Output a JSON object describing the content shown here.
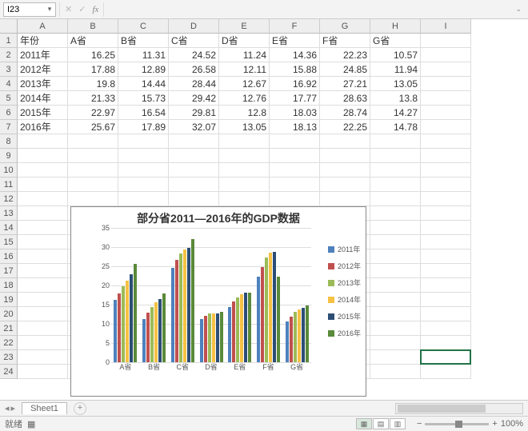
{
  "namebox": "I23",
  "sheet_tab": "Sheet1",
  "zoom_label": "100%",
  "status_text": "就绪",
  "columns": [
    "A",
    "B",
    "C",
    "D",
    "E",
    "F",
    "G",
    "H",
    "I"
  ],
  "row_count": 24,
  "headers": [
    "年份",
    "A省",
    "B省",
    "C省",
    "D省",
    "E省",
    "F省",
    "G省"
  ],
  "data_rows": [
    [
      "2011年",
      "16.25",
      "11.31",
      "24.52",
      "11.24",
      "14.36",
      "22.23",
      "10.57"
    ],
    [
      "2012年",
      "17.88",
      "12.89",
      "26.58",
      "12.11",
      "15.88",
      "24.85",
      "11.94"
    ],
    [
      "2013年",
      "19.8",
      "14.44",
      "28.44",
      "12.67",
      "16.92",
      "27.21",
      "13.05"
    ],
    [
      "2014年",
      "21.33",
      "15.73",
      "29.42",
      "12.76",
      "17.77",
      "28.63",
      "13.8"
    ],
    [
      "2015年",
      "22.97",
      "16.54",
      "29.81",
      "12.8",
      "18.03",
      "28.74",
      "14.27"
    ],
    [
      "2016年",
      "25.67",
      "17.89",
      "32.07",
      "13.05",
      "18.13",
      "22.25",
      "14.78"
    ]
  ],
  "selected_cell": {
    "row": 23,
    "col": 9
  },
  "chart_data": {
    "type": "bar",
    "title": "部分省2011—2016年的GDP数据",
    "ylim": [
      0,
      35
    ],
    "ystep": 5,
    "categories": [
      "A省",
      "B省",
      "C省",
      "D省",
      "E省",
      "F省",
      "G省"
    ],
    "series": [
      {
        "name": "2011年",
        "color": "#4e81bd",
        "values": [
          16.25,
          11.31,
          24.52,
          11.24,
          14.36,
          22.23,
          10.57
        ]
      },
      {
        "name": "2012年",
        "color": "#c0504e",
        "values": [
          17.88,
          12.89,
          26.58,
          12.11,
          15.88,
          24.85,
          11.94
        ]
      },
      {
        "name": "2013年",
        "color": "#9bbb58",
        "values": [
          19.8,
          14.44,
          28.44,
          12.67,
          16.92,
          27.21,
          13.05
        ]
      },
      {
        "name": "2014年",
        "color": "#f6c143",
        "values": [
          21.33,
          15.73,
          29.42,
          12.76,
          17.77,
          28.63,
          13.8
        ]
      },
      {
        "name": "2015年",
        "color": "#2c4e75",
        "values": [
          22.97,
          16.54,
          29.81,
          12.8,
          18.03,
          28.74,
          14.27
        ]
      },
      {
        "name": "2016年",
        "color": "#5a8a3a",
        "values": [
          25.67,
          17.89,
          32.07,
          13.05,
          18.13,
          22.25,
          14.78
        ]
      }
    ]
  }
}
